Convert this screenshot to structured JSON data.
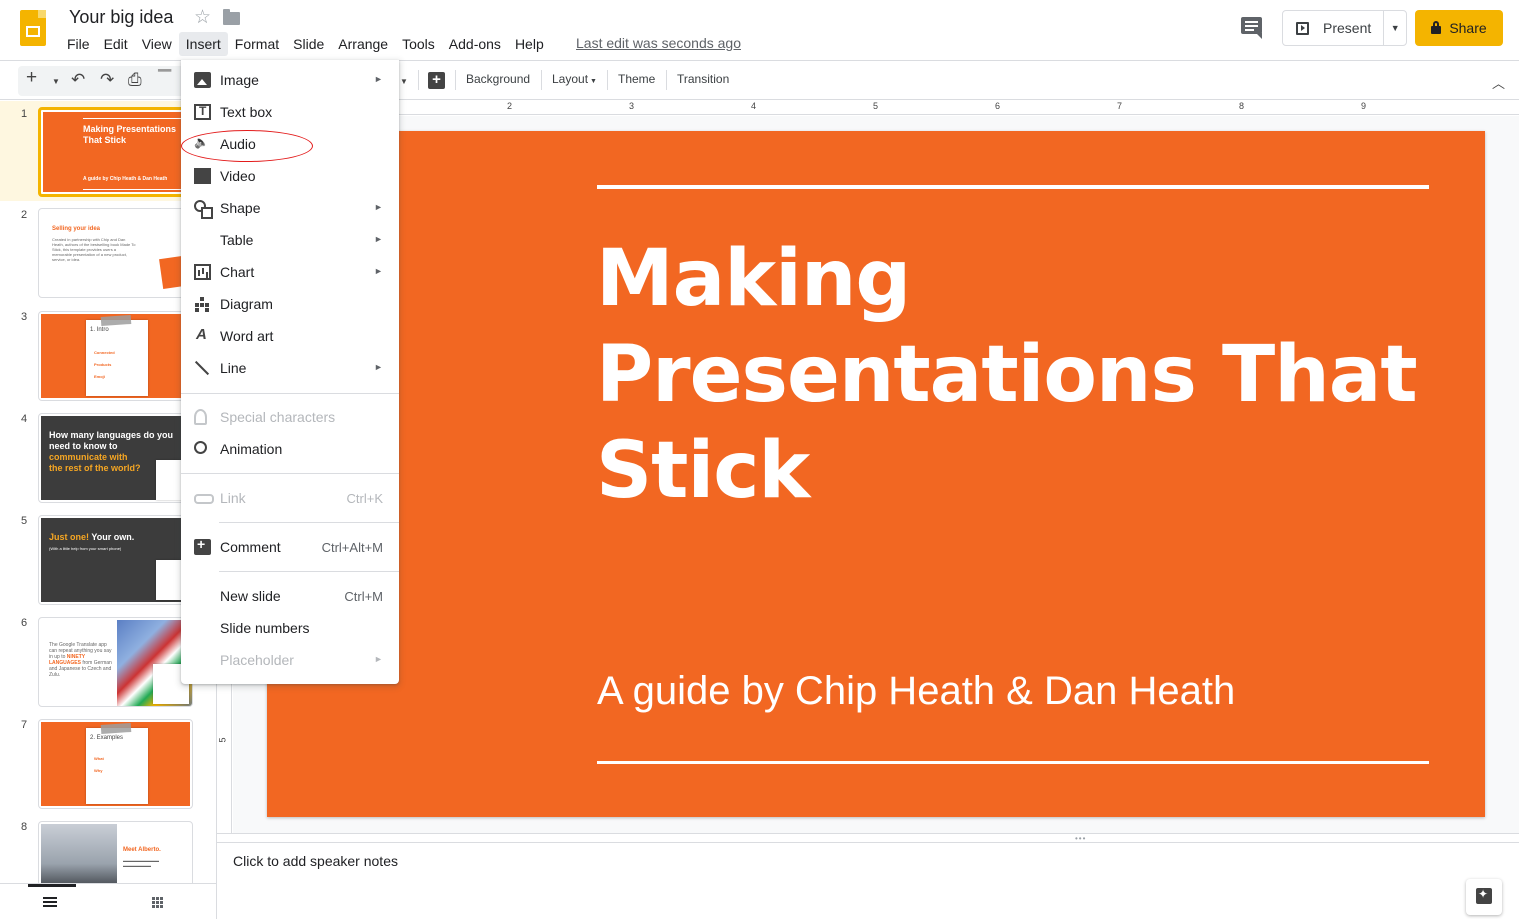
{
  "app": {
    "doc_title": "Your big idea",
    "last_edit": "Last edit was seconds ago",
    "present_label": "Present",
    "share_label": "Share"
  },
  "menubar": [
    "File",
    "Edit",
    "View",
    "Insert",
    "Format",
    "Slide",
    "Arrange",
    "Tools",
    "Add-ons",
    "Help"
  ],
  "toolbar": {
    "background": "Background",
    "layout": "Layout",
    "theme": "Theme",
    "transition": "Transition"
  },
  "insert_menu": {
    "items": [
      {
        "label": "Image",
        "submenu": true,
        "icon": "image-icon"
      },
      {
        "label": "Text box",
        "icon": "text-box-icon"
      },
      {
        "label": "Audio",
        "icon": "audio-icon"
      },
      {
        "label": "Video",
        "icon": "video-icon"
      },
      {
        "label": "Shape",
        "submenu": true,
        "icon": "shape-icon"
      },
      {
        "label": "Table",
        "submenu": true
      },
      {
        "label": "Chart",
        "submenu": true,
        "icon": "chart-icon"
      },
      {
        "label": "Diagram",
        "icon": "diagram-icon"
      },
      {
        "label": "Word art",
        "icon": "word-art-icon"
      },
      {
        "label": "Line",
        "submenu": true,
        "icon": "line-icon"
      },
      {
        "label": "Special characters",
        "disabled": true,
        "icon": "special-characters-icon"
      },
      {
        "label": "Animation",
        "icon": "animation-icon"
      },
      {
        "label": "Link",
        "shortcut": "Ctrl+K",
        "disabled": true,
        "icon": "link-icon"
      },
      {
        "label": "Comment",
        "shortcut": "Ctrl+Alt+M",
        "icon": "comment-icon"
      },
      {
        "label": "New slide",
        "shortcut": "Ctrl+M"
      },
      {
        "label": "Slide numbers"
      },
      {
        "label": "Placeholder",
        "submenu": true,
        "disabled": true
      }
    ]
  },
  "ruler": {
    "h_numbers": [
      "2",
      "3",
      "4",
      "5",
      "6",
      "7",
      "8",
      "9"
    ],
    "v_number": "5"
  },
  "filmstrip": {
    "numbers": [
      "1",
      "2",
      "3",
      "4",
      "5",
      "6",
      "7",
      "8"
    ],
    "slide1": {
      "title": "Making Presentations That Stick",
      "sub": "A guide by Chip Heath & Dan Heath"
    },
    "slide2": {
      "title": "Selling your idea",
      "body": "Created in partnership with Chip and Dan Heath, authors of the bestselling book Made To Stick, this template provides users a memorable presentation of a new product, service, or idea."
    },
    "slide3": {
      "heading": "1. Intro",
      "b1": "Connected",
      "b2": "Products",
      "b3": "Emoji"
    },
    "slide4": {
      "line1": "How many languages do you need to know to",
      "line2": "communicate with",
      "line3": "the rest of the world?"
    },
    "slide5": {
      "a": "Just one!",
      "b": "Your own.",
      "sub": "(With a little help from your smart phone)"
    },
    "slide6": {
      "text1": "The Google Translate app can repeat anything you say in up to",
      "hl": "NINETY LANGUAGES",
      "text2": "from German and Japanese to Czech and Zulu."
    },
    "slide7": {
      "heading": "2. Examples",
      "b1": "What",
      "b2": "Why"
    },
    "slide8": {
      "title": "Meet Alberto."
    }
  },
  "slide": {
    "title": "Making Presentations That Stick",
    "subtitle": "A guide by Chip Heath & Dan Heath"
  },
  "notes": {
    "placeholder": "Click to add speaker notes"
  },
  "colors": {
    "accent": "#f4b400",
    "slide_orange": "#f26722",
    "annotation_red": "#e31b1b"
  }
}
